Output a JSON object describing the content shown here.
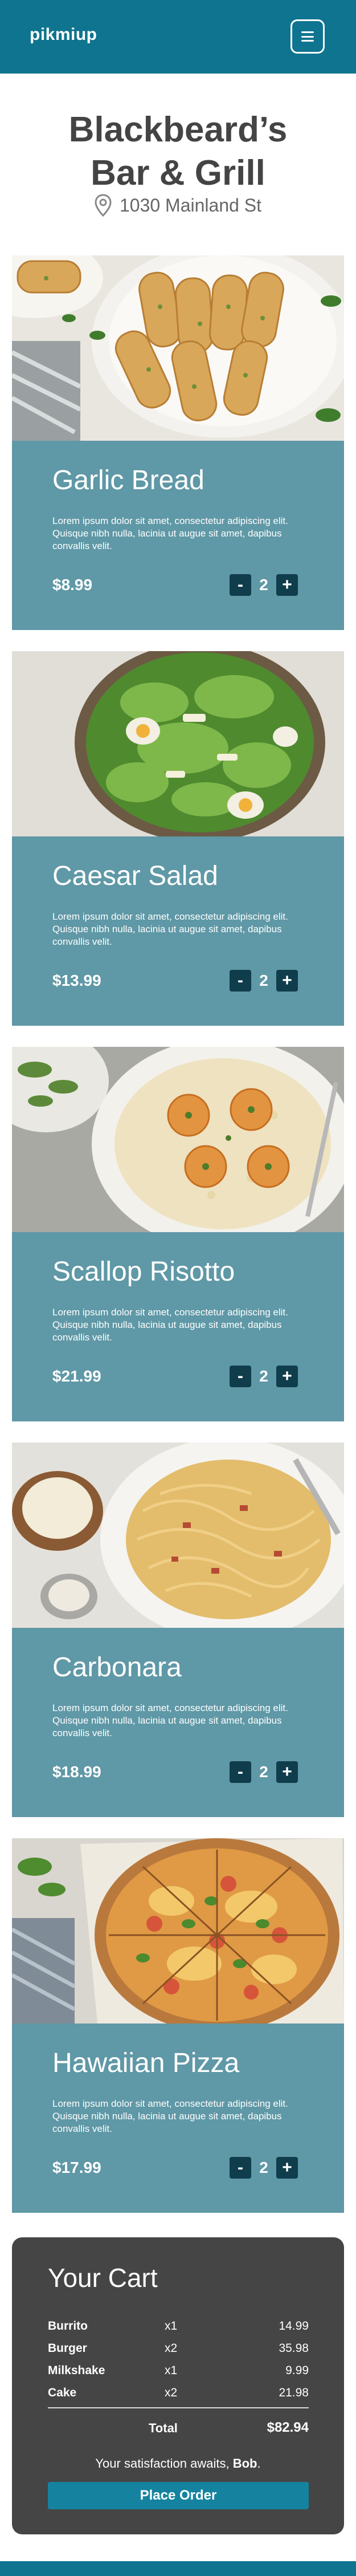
{
  "header": {
    "logo": "pikmiup",
    "menu_icon": "hamburger-menu-icon"
  },
  "restaurant": {
    "name_line1": "Blackbeard’s",
    "name_line2": "Bar & Grill",
    "address": "1030 Mainland St",
    "address_icon": "location-pin-icon"
  },
  "menu": [
    {
      "name": "Garlic Bread",
      "description": "Lorem ipsum dolor sit amet, consectetur adipiscing elit. Quisque nibh nulla, lacinia ut augue sit amet, dapibus convallis velit.",
      "price": "$8.99",
      "qty": "2"
    },
    {
      "name": "Caesar Salad",
      "description": "Lorem ipsum dolor sit amet, consectetur adipiscing elit. Quisque nibh nulla, lacinia ut augue sit amet, dapibus convallis velit.",
      "price": "$13.99",
      "qty": "2"
    },
    {
      "name": "Scallop Risotto",
      "description": "Lorem ipsum dolor sit amet, consectetur adipiscing elit. Quisque nibh nulla, lacinia ut augue sit amet, dapibus convallis velit.",
      "price": "$21.99",
      "qty": "2"
    },
    {
      "name": "Carbonara",
      "description": "Lorem ipsum dolor sit amet, consectetur adipiscing elit. Quisque nibh nulla, lacinia ut augue sit amet, dapibus convallis velit.",
      "price": "$18.99",
      "qty": "2"
    },
    {
      "name": "Hawaiian Pizza",
      "description": "Lorem ipsum dolor sit amet, consectetur adipiscing elit. Quisque nibh nulla, lacinia ut augue sit amet, dapibus convallis velit.",
      "price": "$17.99",
      "qty": "2"
    }
  ],
  "stepper": {
    "minus": "-",
    "plus": "+"
  },
  "cart": {
    "title": "Your Cart",
    "items": [
      {
        "name": "Burrito",
        "qty": "x1",
        "price": "14.99"
      },
      {
        "name": "Burger",
        "qty": "x2",
        "price": "35.98"
      },
      {
        "name": "Milkshake",
        "qty": "x1",
        "price": "9.99"
      },
      {
        "name": "Cake",
        "qty": "x2",
        "price": "21.98"
      }
    ],
    "total_label": "Total",
    "total_value": "$82.94",
    "satisfaction_prefix": "Your satisfaction awaits, ",
    "user_name": "Bob",
    "satisfaction_suffix": ".",
    "order_button": "Place Order"
  },
  "colors": {
    "brand": "#0e7490",
    "panel": "#5f98a6",
    "stepper": "#0f3d4c",
    "cart_bg": "#454545",
    "order_button": "#1583a0"
  }
}
